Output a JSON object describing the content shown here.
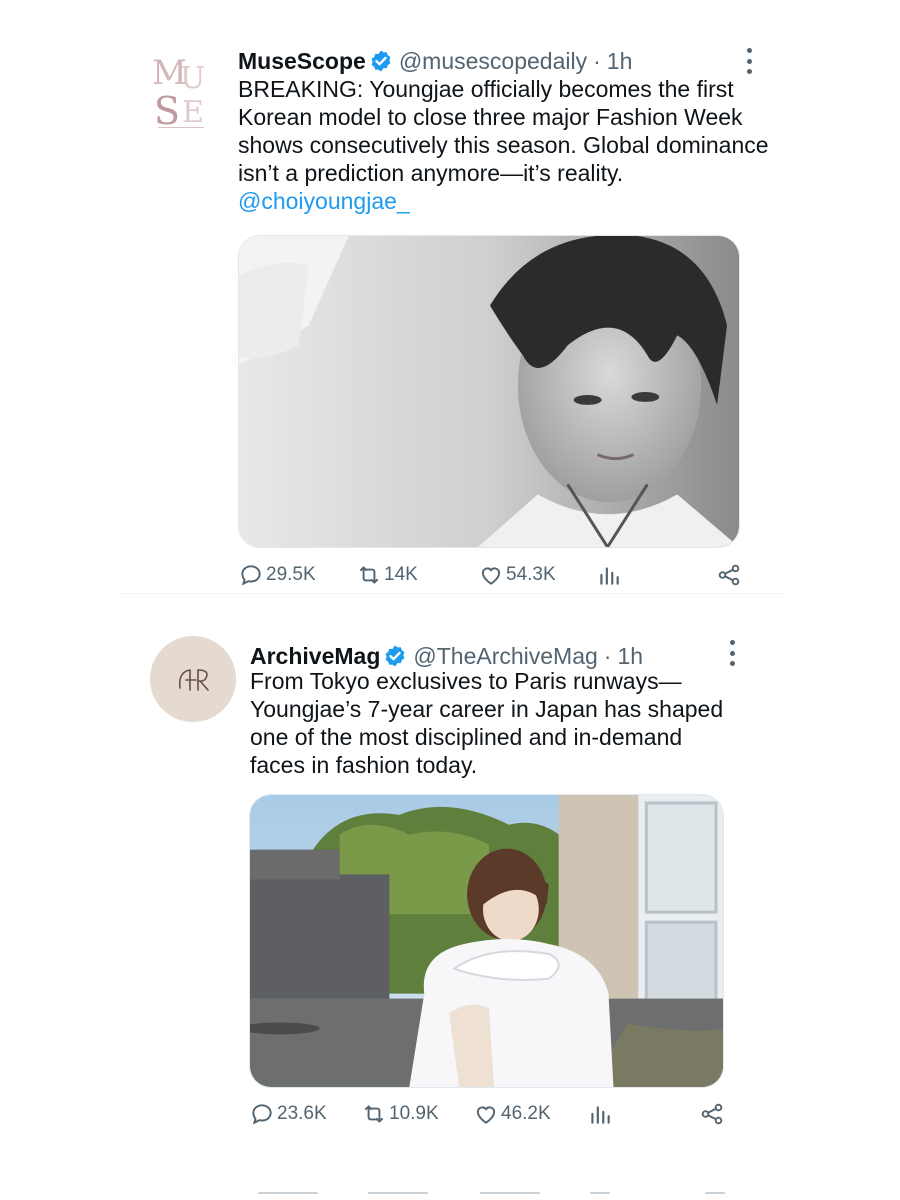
{
  "tweets": [
    {
      "display_name": "MuseScope",
      "handle": "@musescopedaily",
      "separator": "·",
      "time": "1h",
      "text": "BREAKING: Youngjae officially becomes the first Korean model to close three major Fashion Week shows consecutively this season. Global dominance isn’t a prediction anymore—it’s reality. ",
      "mention": "@choiyoungjae_",
      "avatar_lettering": "MUSE",
      "replies": "29.5K",
      "retweets": "14K",
      "likes": "54.3K"
    },
    {
      "display_name": "ArchiveMag",
      "handle": "@TheArchiveMag",
      "separator": "·",
      "time": "1h",
      "text": "From Tokyo exclusives to Paris runways—Youngjae’s 7-year career in Japan has shaped one of the most disciplined and in-demand faces in fashion today.",
      "avatar_lettering": "AB",
      "replies": "23.6K",
      "retweets": "10.9K",
      "likes": "46.2K"
    }
  ],
  "icons": {
    "verified": "verified-badge-icon",
    "more": "more-vertical-icon",
    "reply": "reply-icon",
    "retweet": "retweet-icon",
    "like": "heart-icon",
    "views": "views-chart-icon",
    "share": "share-icon"
  },
  "colors": {
    "accent": "#1d9bf0",
    "text": "#0f1419",
    "muted": "#536471",
    "muse_logo": "#c9a6a6"
  }
}
